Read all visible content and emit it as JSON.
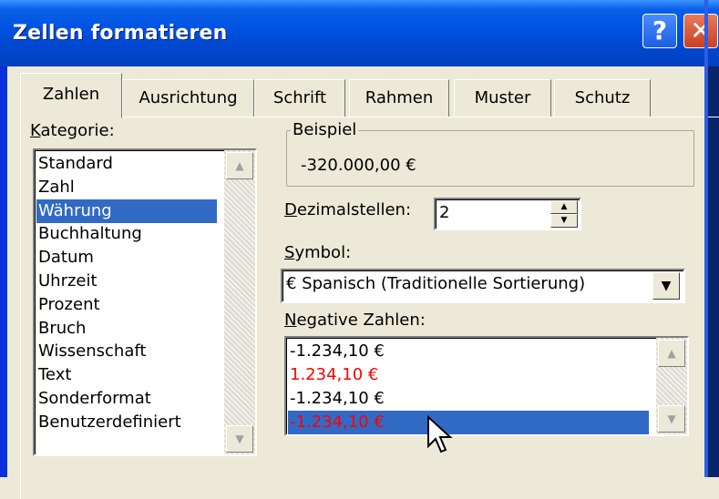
{
  "window": {
    "title": "Zellen formatieren",
    "help_glyph": "?",
    "close_glyph": "✕"
  },
  "tabs": [
    {
      "label": "Zahlen",
      "active": true
    },
    {
      "label": "Ausrichtung"
    },
    {
      "label": "Schrift"
    },
    {
      "label": "Rahmen"
    },
    {
      "label": "Muster"
    },
    {
      "label": "Schutz"
    }
  ],
  "category": {
    "label_first": "K",
    "label_rest": "ategorie:",
    "items": [
      "Standard",
      "Zahl",
      "Währung",
      "Buchhaltung",
      "Datum",
      "Uhrzeit",
      "Prozent",
      "Bruch",
      "Wissenschaft",
      "Text",
      "Sonderformat",
      "Benutzerdefiniert"
    ],
    "selected": "Währung"
  },
  "sample": {
    "label": "Beispiel",
    "value": "-320.000,00 €"
  },
  "decimals": {
    "label_first": "D",
    "label_rest": "ezimalstellen:",
    "value": "2"
  },
  "symbol": {
    "label_first": "S",
    "label_rest": "ymbol:",
    "value": "€ Spanisch (Traditionelle Sortierung)"
  },
  "negative": {
    "label_first": "N",
    "label_rest": "egative Zahlen:",
    "items": [
      {
        "text": "-1.234,10 €",
        "color": "#000000"
      },
      {
        "text": "1.234,10 €",
        "color": "#ff0000"
      },
      {
        "text": "-1.234,10 €",
        "color": "#000000"
      },
      {
        "text": "-1.234,10 €",
        "color": "#ff0000",
        "selected": true
      }
    ]
  },
  "colors": {
    "titlebar": "#0054e3",
    "selection": "#316ac5",
    "dialog_bg": "#ece9d8"
  }
}
